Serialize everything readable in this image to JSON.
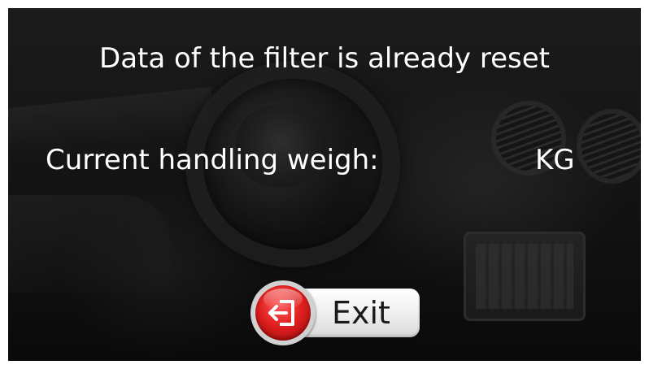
{
  "message": {
    "title": "Data of the filter is already reset"
  },
  "handling_weigh": {
    "label": "Current handling weigh:",
    "value": "",
    "unit": "KG"
  },
  "exit_button": {
    "label": "Exit",
    "icon": "exit-door-arrow-icon",
    "accent_color": "#d81e1e"
  },
  "colors": {
    "text": "#ffffff",
    "background": "#121212"
  }
}
